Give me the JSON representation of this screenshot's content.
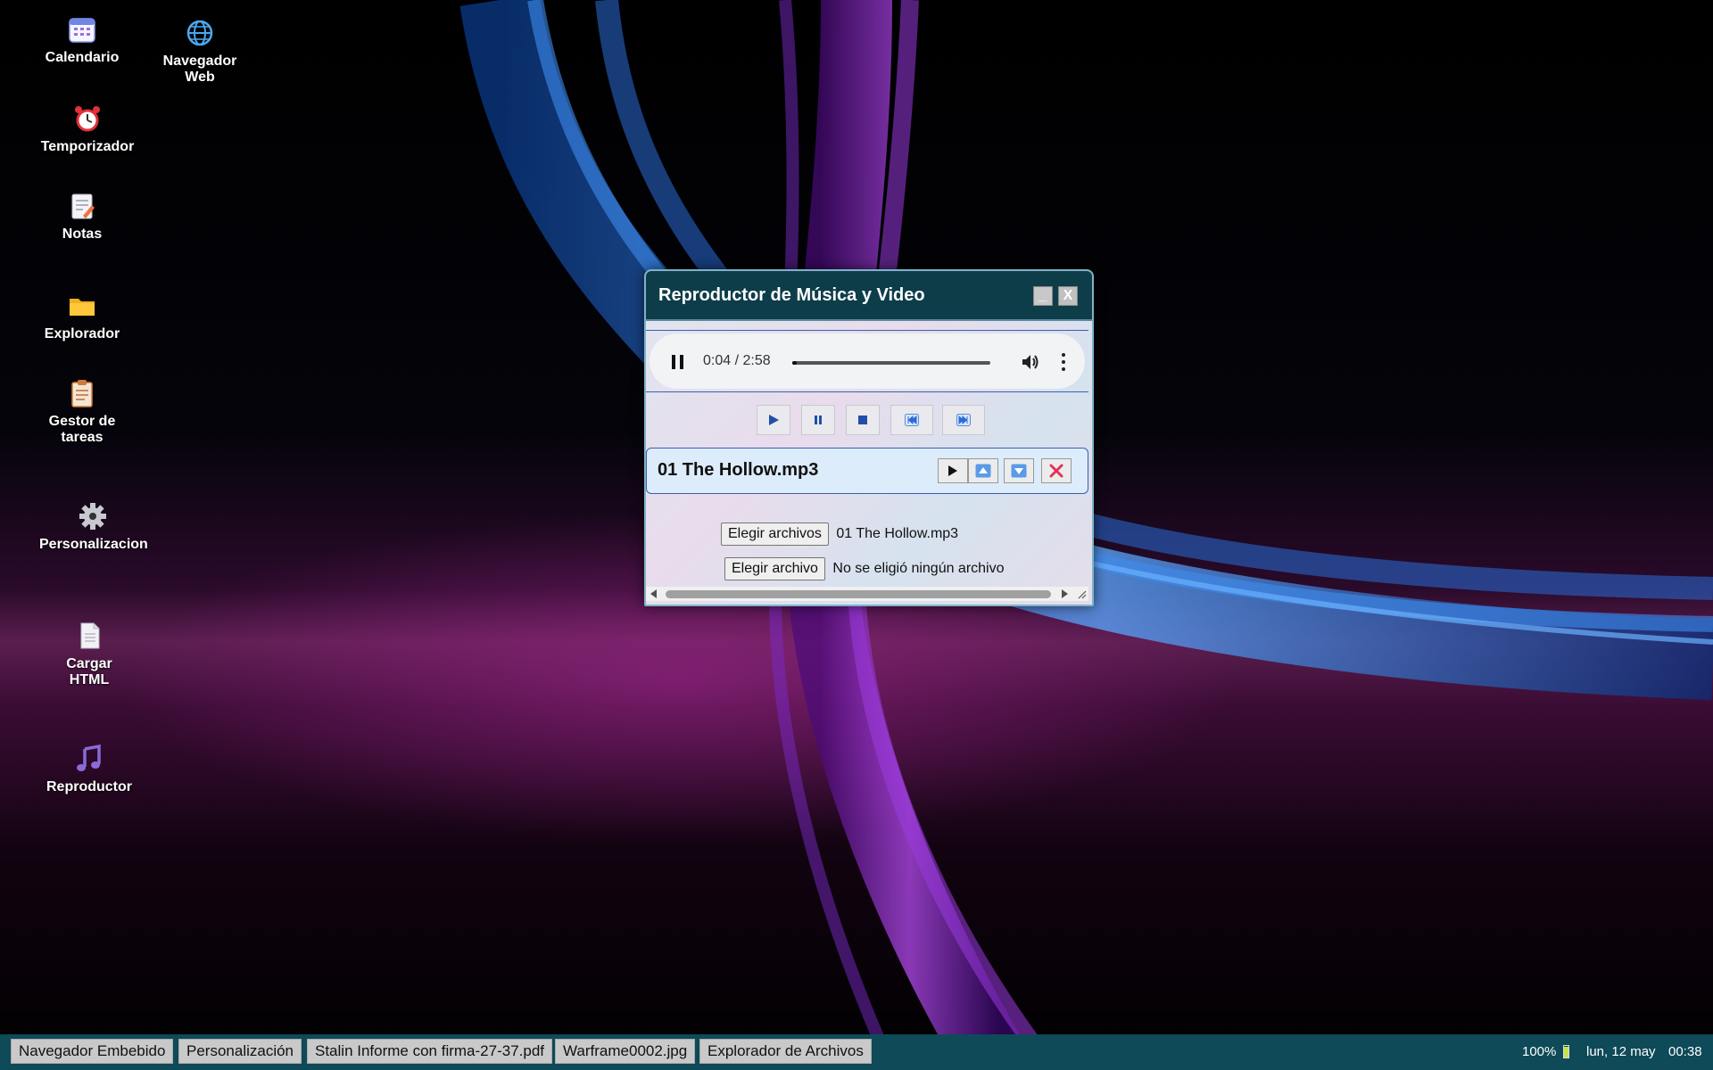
{
  "desktop": {
    "icons": [
      {
        "label": "Calendario",
        "icon": "calendar-icon"
      },
      {
        "label": "Navegador Web",
        "icon": "globe-icon"
      },
      {
        "label": "Temporizador",
        "icon": "alarm-clock-icon"
      },
      {
        "label": "Notas",
        "icon": "notes-icon"
      },
      {
        "label": "Explorador",
        "icon": "folder-icon"
      },
      {
        "label": "Gestor de tareas",
        "icon": "clipboard-icon"
      },
      {
        "label": "Personalizacion",
        "icon": "gear-icon"
      },
      {
        "label": "Cargar HTML",
        "icon": "document-icon"
      },
      {
        "label": "Reproductor",
        "icon": "music-note-icon"
      }
    ]
  },
  "player": {
    "title": "Reproductor de Música y Video",
    "minimize_label": "_",
    "close_label": "X",
    "audio": {
      "time": "0:04 / 2:58",
      "progress_fraction": 0.022
    },
    "controls": [
      "play-icon",
      "pause-icon",
      "stop-icon",
      "rewind-icon",
      "fast-forward-icon"
    ],
    "track": {
      "name": "01 The Hollow.mp3",
      "buttons": [
        "play-icon",
        "move-up-icon",
        "move-down-icon",
        "remove-icon"
      ]
    },
    "files_input": {
      "button": "Elegir archivos",
      "value": "01 The Hollow.mp3"
    },
    "file_input": {
      "button": "Elegir archivo",
      "value": "No se eligió ningún archivo"
    }
  },
  "taskbar": {
    "items": [
      "Navegador Embebido",
      "Personalización",
      "Stalin Informe con firma-27-37.pdf",
      "Warframe0002.jpg",
      "Explorador de Archivos"
    ],
    "battery": "100%",
    "date": "lun, 12 may",
    "time": "00:38"
  },
  "colors": {
    "titlebar": "#0e3d4a",
    "taskbar": "#0e4a57",
    "accent_blue": "#1f4fa8",
    "remove_red": "#e0335a"
  }
}
